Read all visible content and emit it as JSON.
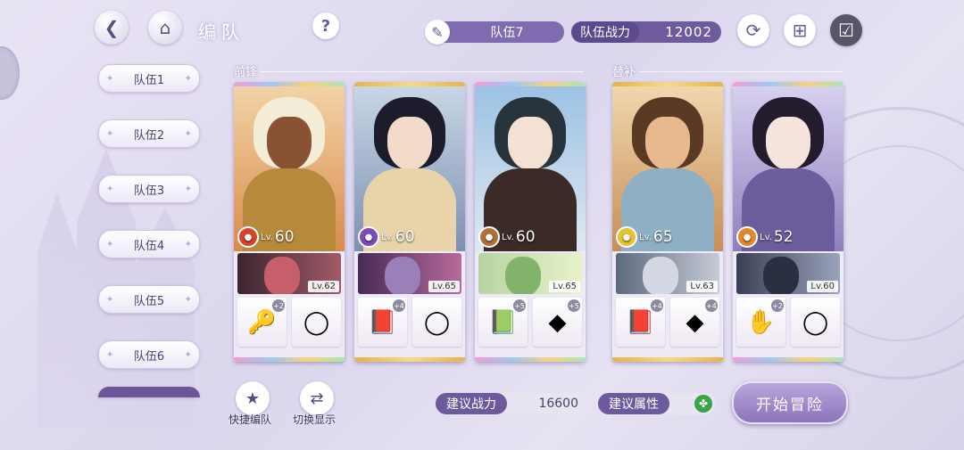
{
  "header": {
    "title": "编队",
    "team_name": "队伍7",
    "team_power_label": "队伍战力",
    "team_power_value": "12002",
    "help": "?"
  },
  "teams": [
    "队伍1",
    "队伍2",
    "队伍3",
    "队伍4",
    "队伍5",
    "队伍6"
  ],
  "sections": {
    "front": "前锋",
    "sub": "替补"
  },
  "cards": [
    {
      "level": "60",
      "support_level": "Lv.62",
      "items": [
        {
          "icon": "key-icon",
          "glyph": "🔑",
          "plus": "+2"
        },
        {
          "icon": "ring-icon",
          "glyph": "◯",
          "plus": ""
        }
      ],
      "element_color": "#d2452f",
      "frame": "rainbow"
    },
    {
      "level": "60",
      "support_level": "Lv.65",
      "items": [
        {
          "icon": "book-icon",
          "glyph": "📕",
          "plus": "+4"
        },
        {
          "icon": "ring-icon",
          "glyph": "◯",
          "plus": ""
        }
      ],
      "element_color": "#7b4bb8",
      "frame": "gold"
    },
    {
      "level": "60",
      "support_level": "Lv.65",
      "items": [
        {
          "icon": "book-icon",
          "glyph": "📗",
          "plus": "+5"
        },
        {
          "icon": "gem-icon",
          "glyph": "◆",
          "plus": "+5"
        }
      ],
      "element_color": "#b0703a",
      "frame": "rainbow"
    },
    {
      "level": "65",
      "support_level": "Lv.63",
      "items": [
        {
          "icon": "book-icon",
          "glyph": "📕",
          "plus": "+4"
        },
        {
          "icon": "gem-icon",
          "glyph": "◆",
          "plus": "+4"
        }
      ],
      "element_color": "#e7c32f",
      "frame": "gold"
    },
    {
      "level": "52",
      "support_level": "Lv.60",
      "items": [
        {
          "icon": "glove-icon",
          "glyph": "✋",
          "plus": "+2"
        },
        {
          "icon": "ring-icon",
          "glyph": "◯",
          "plus": ""
        }
      ],
      "element_color": "#e2892a",
      "frame": "rainbow"
    }
  ],
  "bottom": {
    "quick_form": "快捷编队",
    "switch_display": "切换显示",
    "suggested_power_label": "建议战力",
    "suggested_power_value": "16600",
    "suggested_attr_label": "建议属性",
    "start": "开始冒险"
  },
  "lv_prefix": "Lv."
}
